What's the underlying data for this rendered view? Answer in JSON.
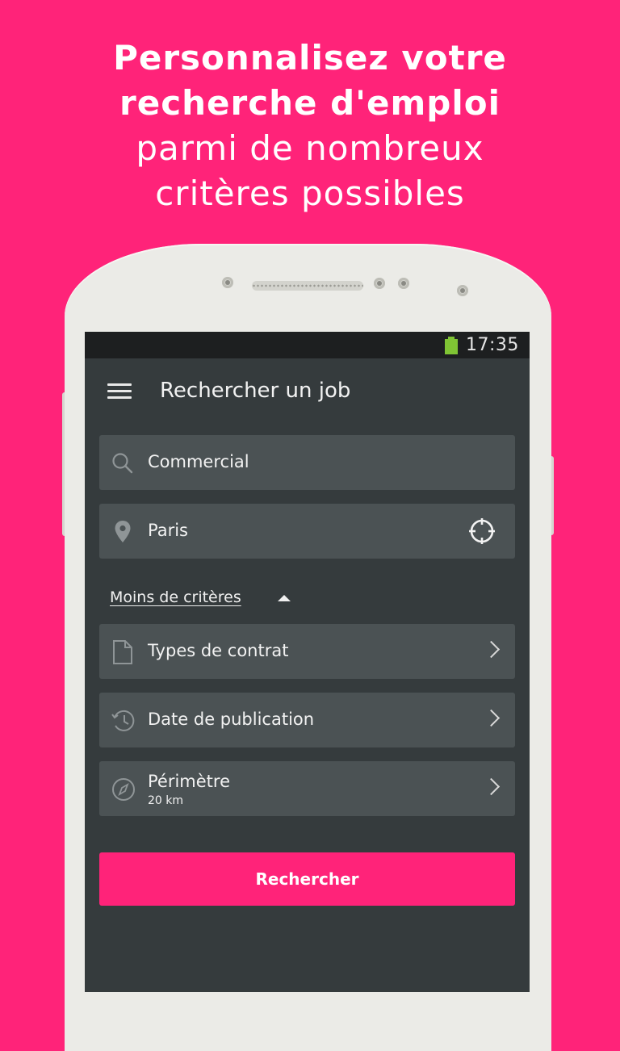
{
  "headline": {
    "line1": "Personnalisez votre",
    "line2": "recherche d'emploi",
    "line3": "parmi de nombreux",
    "line4": "critères possibles"
  },
  "statusbar": {
    "time": "17:35",
    "battery_color": "#7fc434"
  },
  "appbar": {
    "title": "Rechercher un job",
    "menu_icon": "menu-icon"
  },
  "search": {
    "keyword": {
      "icon": "search-icon",
      "value": "Commercial"
    },
    "location": {
      "icon": "location-pin-icon",
      "value": "Paris",
      "action_icon": "crosshair-locate-icon"
    }
  },
  "criteria_toggle": {
    "label": "Moins de critères",
    "icon": "caret-up-icon"
  },
  "filters": [
    {
      "icon": "document-icon",
      "label": "Types de contrat"
    },
    {
      "icon": "history-clock-icon",
      "label": "Date de publication"
    },
    {
      "icon": "compass-icon",
      "label": "Périmètre",
      "value": "20 km"
    }
  ],
  "submit_label": "Rechercher",
  "colors": {
    "brand": "#ff2379",
    "screen_bg": "#353b3d",
    "field_bg": "#4b5254"
  }
}
